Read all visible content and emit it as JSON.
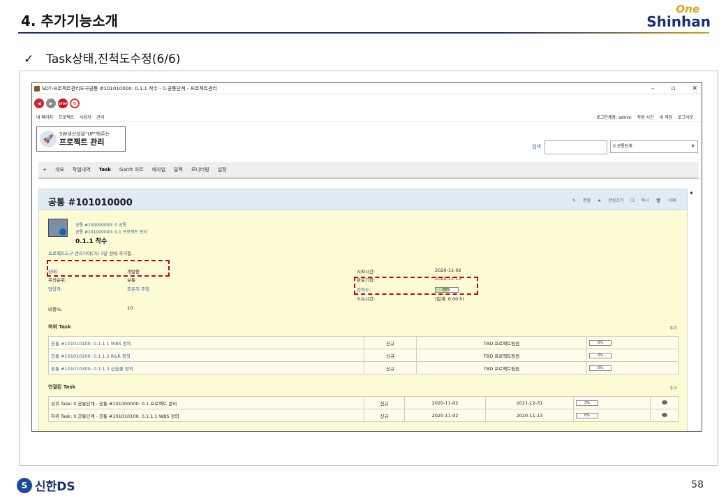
{
  "slide": {
    "title": "4. 추가기능소개",
    "subtitle": "Task상태,진척도수정(6/6)",
    "check": "✓",
    "brand_one": "One",
    "brand_shinhan": "Shinhan",
    "footer_logo": "신한DS",
    "page_number": "58"
  },
  "window": {
    "title": "SDT-프로젝트관리도구공통 #101010000: 0.1.1 착수 - 0.공통단계 - 프로젝트관리",
    "min": "–",
    "max": "▫",
    "close": "✕"
  },
  "nav_buttons": {
    "back": "◀",
    "forward": "▶",
    "stop": "STOP",
    "reload": "↻"
  },
  "topbar": {
    "left": [
      "내 페이지",
      "프로젝트",
      "사용자",
      "관리"
    ],
    "right": [
      "로그인계정: admin",
      "작업 시간",
      "내 계정",
      "로그아웃"
    ]
  },
  "header": {
    "logo_line1": "SW생산성을\"UP\"해주는",
    "logo_line2": "프로젝트 관리",
    "search_label": "검색",
    "project_select": "0.공통단계",
    "select_arrow": "▼"
  },
  "menu": {
    "plus": "+",
    "items": [
      "개요",
      "작업내역",
      "Task",
      "Gantt 차트",
      "예자일",
      "달력",
      "모니터링",
      "설정"
    ],
    "active_index": 2
  },
  "issue": {
    "header_title": "공통 #101010000",
    "actions": [
      "편집",
      "관심끄기",
      "복사",
      "삭제"
    ],
    "parent1": "공통 #100000000: 0 공통",
    "parent2": "공통 #101000000: 0.1 프로젝트 관리",
    "subject": "0.1.1 착수",
    "added_by_prefix": "프로젝트도구 관리자",
    "added_by_mid": "이(가) ",
    "added_ago": "3달",
    "added_suffix": " 전에 추가함.",
    "fields": {
      "status_label": "상태:",
      "status_value": "개발중",
      "priority_label": "우선순위:",
      "priority_value": "보통",
      "assignee_label": "담당자:",
      "assignee_value": "조은지 주임",
      "weight_label": "비중%:",
      "weight_value": "10",
      "start_label": "시작시간:",
      "start_value": "2020-11-02",
      "due_label": "완료기한:",
      "due_value": "2020-11-13",
      "progress_label": "진척도:",
      "progress_value": "60%",
      "progress_fraction": 0.6,
      "spent_label": "소요시간:",
      "spent_value": "(합계: 0.00 h)"
    }
  },
  "subtasks": {
    "title": "하위 Task",
    "add": "추가",
    "rows": [
      {
        "name": "공통 #101010100: 0.1.1.1 WBS 정의",
        "status": "신규",
        "assignee": "TBD 프로젝트팀원",
        "progress": "0%"
      },
      {
        "name": "공통 #101010200: 0.1.1.2 R&R 정의",
        "status": "신규",
        "assignee": "TBD 프로젝트팀원",
        "progress": "0%"
      },
      {
        "name": "공통 #101010300: 0.1.1.3 산출물 정의",
        "status": "신규",
        "assignee": "TBD 프로젝트팀원",
        "progress": "0%"
      }
    ]
  },
  "related": {
    "title": "연결된 Task",
    "add": "추가",
    "rows": [
      {
        "name": "상위 Task: 0.공통단계 - 공통 #101000000: 0.1 프로젝트 관리",
        "status": "신규",
        "start": "2020-11-02",
        "end": "2021-12-31",
        "progress": "3%"
      },
      {
        "name": "하위 Task: 0.공통단계 - 공통 #101010100: 0.1.1.1 WBS 정의",
        "status": "신규",
        "start": "2020-11-02",
        "end": "2020-11-13",
        "progress": "0%"
      }
    ]
  }
}
